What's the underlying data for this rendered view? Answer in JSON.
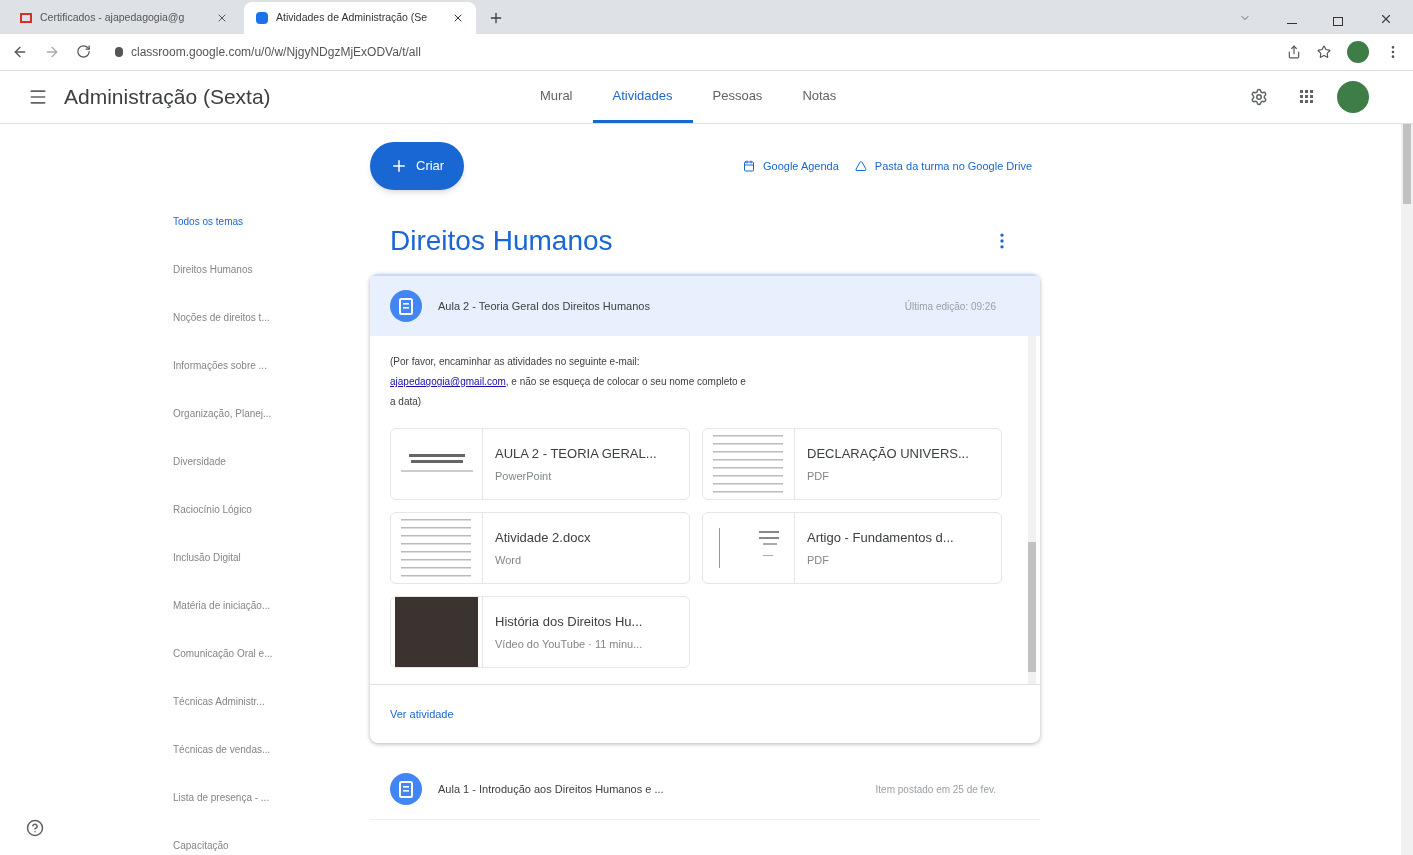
{
  "browser": {
    "tabs": [
      {
        "label": "Certificados - ajapedagogia@g",
        "selected": false
      },
      {
        "label": "Atividades de Administração (Se",
        "selected": true
      }
    ],
    "url": "classroom.google.com/u/0/w/NjgyNDgzMjExODVa/t/all"
  },
  "header": {
    "title": "Administração (Sexta)",
    "nav": [
      {
        "label": "Mural",
        "selected": false
      },
      {
        "label": "Atividades",
        "selected": true
      },
      {
        "label": "Pessoas",
        "selected": false
      },
      {
        "label": "Notas",
        "selected": false
      }
    ]
  },
  "toolbar": {
    "create": "Criar",
    "links": [
      {
        "label": "Google Agenda"
      },
      {
        "label": "Pasta da turma no Google Drive"
      }
    ]
  },
  "topics": [
    {
      "label": "Todos os temas",
      "selected": true
    },
    {
      "label": "Direitos Humanos",
      "selected": false
    },
    {
      "label": "Noções de direitos t...",
      "selected": false
    },
    {
      "label": "Informações sobre ...",
      "selected": false
    },
    {
      "label": "Organização, Planej...",
      "selected": false
    },
    {
      "label": "Diversidade",
      "selected": false
    },
    {
      "label": "Raciocínio Lógico",
      "selected": false
    },
    {
      "label": "Inclusão Digital",
      "selected": false
    },
    {
      "label": "Matéria de iniciação...",
      "selected": false
    },
    {
      "label": "Comunicação Oral e...",
      "selected": false
    },
    {
      "label": "Técnicas Administr...",
      "selected": false
    },
    {
      "label": "Técnicas de vendas...",
      "selected": false
    },
    {
      "label": "Lista de presença - ...",
      "selected": false
    },
    {
      "label": "Capacitação",
      "selected": false
    }
  ],
  "section": {
    "title": "Direitos Humanos",
    "items": [
      {
        "title": "Aula 2 - Teoria Geral dos Direitos Humanos",
        "meta": "Última edição: 09:26",
        "expanded": true,
        "description": "(Por favor, encaminhar as atividades no seguinte e-mail:",
        "email": "ajapedagogia@gmail.com",
        "description_rest": ", e não se esqueça de colocar o seu nome completo e a data)",
        "attachments": [
          {
            "kind": "slides",
            "title": "AULA 2 - TEORIA GERAL...",
            "type": "PowerPoint"
          },
          {
            "kind": "document",
            "title": "DECLARAÇÃO UNIVERS...",
            "type": "PDF"
          },
          {
            "kind": "document",
            "title": "Atividade 2.docx",
            "type": "Word"
          },
          {
            "kind": "article",
            "title": "Artigo - Fundamentos d...",
            "type": "PDF"
          },
          {
            "kind": "video",
            "title": "História dos Direitos Hu...",
            "type": "Vídeo do YouTube · 11 minu..."
          }
        ],
        "action": "Ver atividade"
      },
      {
        "title": "Aula 1 - Introdução aos Direitos Humanos e ...",
        "meta": "Item postado em 25 de fev.",
        "expanded": false
      }
    ]
  }
}
